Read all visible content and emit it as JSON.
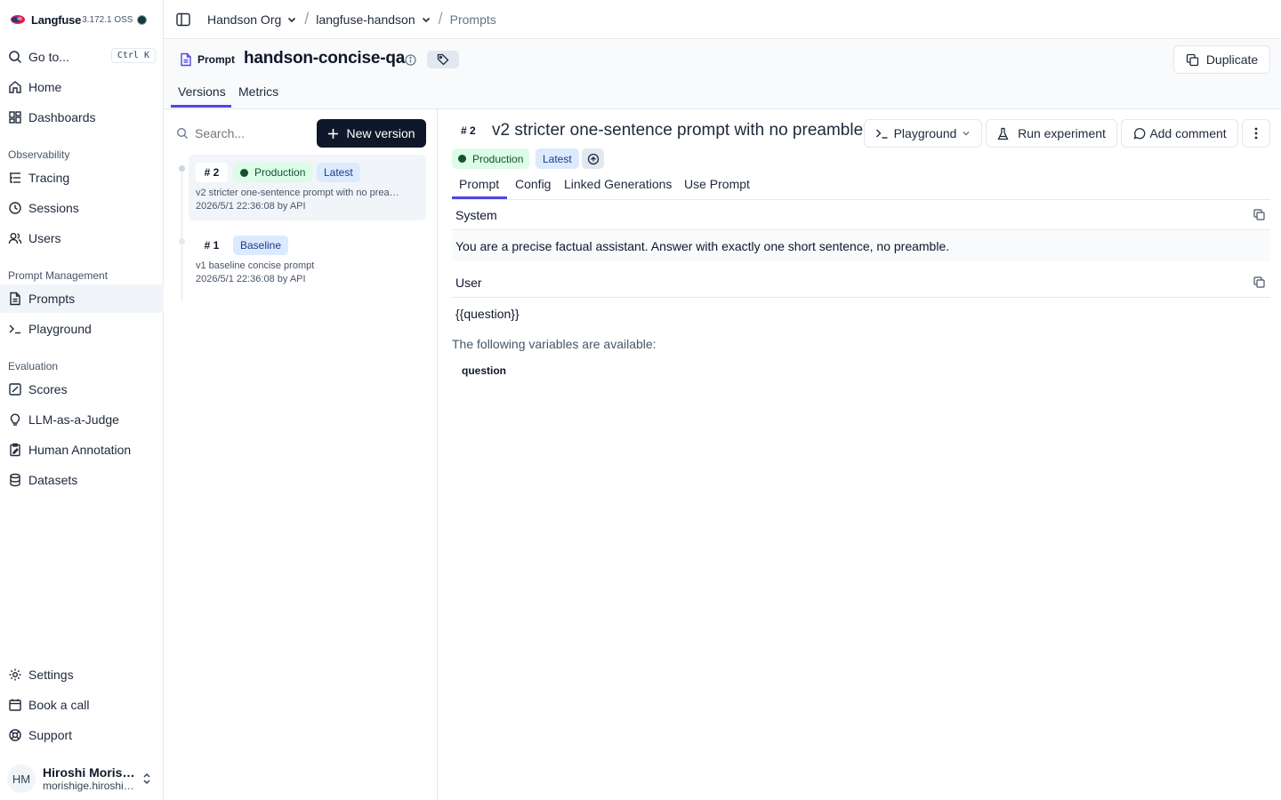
{
  "brand": {
    "name": "Langfuse",
    "version": "3.172.1 OSS"
  },
  "sidebar": {
    "goto": {
      "label": "Go to...",
      "shortcut": "Ctrl K"
    },
    "top_items": [
      {
        "label": "Home"
      },
      {
        "label": "Dashboards"
      }
    ],
    "sections": [
      {
        "title": "Observability",
        "items": [
          {
            "label": "Tracing"
          },
          {
            "label": "Sessions"
          },
          {
            "label": "Users"
          }
        ]
      },
      {
        "title": "Prompt Management",
        "items": [
          {
            "label": "Prompts"
          },
          {
            "label": "Playground"
          }
        ]
      },
      {
        "title": "Evaluation",
        "items": [
          {
            "label": "Scores"
          },
          {
            "label": "LLM-as-a-Judge"
          },
          {
            "label": "Human Annotation"
          },
          {
            "label": "Datasets"
          }
        ]
      }
    ],
    "bottom_items": [
      {
        "label": "Settings"
      },
      {
        "label": "Book a call"
      },
      {
        "label": "Support"
      }
    ],
    "user": {
      "initials": "HM",
      "name": "Hiroshi Moris…",
      "email": "morishige.hiroshi…"
    }
  },
  "breadcrumb": {
    "org": "Handson Org",
    "project": "langfuse-handson",
    "page": "Prompts"
  },
  "prompt": {
    "kind": "Prompt",
    "name": "handson-concise-qa",
    "duplicate": "Duplicate",
    "tabs": {
      "versions": "Versions",
      "metrics": "Metrics"
    }
  },
  "versions_panel": {
    "search_placeholder": "Search...",
    "new_version": "New version",
    "items": [
      {
        "num": "# 2",
        "labels": [
          "Production",
          "Latest"
        ],
        "desc": "v2 stricter one-sentence prompt with no prea…",
        "meta": "2026/5/1 22:36:08 by API"
      },
      {
        "num": "# 1",
        "labels": [
          "Baseline"
        ],
        "desc": "v1 baseline concise prompt",
        "meta": "2026/5/1 22:36:08 by API"
      }
    ]
  },
  "detail": {
    "num": "# 2",
    "title": "v2 stricter one-sentence prompt with no preamble",
    "actions": {
      "playground": "Playground",
      "run_experiment": "Run experiment",
      "add_comment": "Add comment"
    },
    "badges": {
      "production": "Production",
      "latest": "Latest"
    },
    "tabs": [
      "Prompt",
      "Config",
      "Linked Generations",
      "Use Prompt"
    ],
    "messages": [
      {
        "role": "System",
        "content": "You are a precise factual assistant. Answer with exactly one short sentence, no preamble."
      },
      {
        "role": "User",
        "content": "{{question}}"
      }
    ],
    "variables_label": "The following variables are available:",
    "variables": [
      "question"
    ]
  },
  "colors": {
    "accent": "#4f46e5",
    "primary_button": "#0f172a",
    "production": "#dcfce7",
    "latest": "#dbeafe"
  }
}
